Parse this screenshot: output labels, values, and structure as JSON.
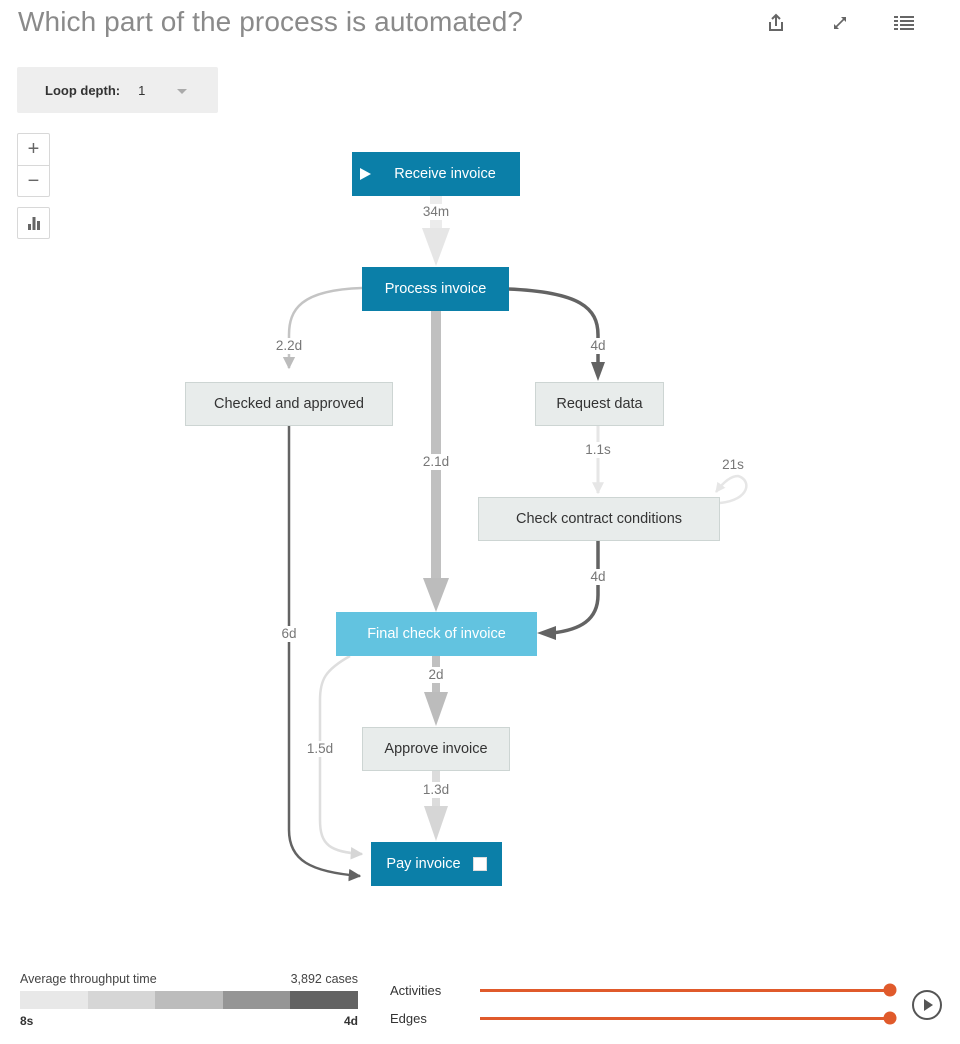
{
  "header": {
    "title": "Which part of the process is automated?",
    "icons": [
      "share-icon",
      "expand-icon",
      "list-icon"
    ]
  },
  "controls": {
    "loop_depth_label": "Loop depth:",
    "loop_depth_value": "1",
    "zoom_in": "+",
    "zoom_out": "−"
  },
  "colors": {
    "node_dark": "#0b7fa8",
    "node_cyan": "#62c3e0",
    "node_light": "#e8eceb",
    "slider": "#e05a2b",
    "legend_scale": [
      "#e8e8e8",
      "#d6d6d6",
      "#bcbcbc",
      "#959595",
      "#636363"
    ]
  },
  "nodes": [
    {
      "id": "receive",
      "label": "Receive invoice",
      "style": "dark",
      "start": true
    },
    {
      "id": "process",
      "label": "Process invoice",
      "style": "dark"
    },
    {
      "id": "checked",
      "label": "Checked and approved",
      "style": "light"
    },
    {
      "id": "request",
      "label": "Request data",
      "style": "light"
    },
    {
      "id": "contract",
      "label": "Check contract conditions",
      "style": "light"
    },
    {
      "id": "final",
      "label": "Final check of invoice",
      "style": "cyan"
    },
    {
      "id": "approve",
      "label": "Approve invoice",
      "style": "light"
    },
    {
      "id": "pay",
      "label": "Pay invoice",
      "style": "dark",
      "end": true
    }
  ],
  "edges": [
    {
      "from": "receive",
      "to": "process",
      "label": "34m",
      "shade": 0
    },
    {
      "from": "process",
      "to": "checked",
      "label": "2.2d",
      "shade": 2
    },
    {
      "from": "process",
      "to": "final",
      "label": "2.1d",
      "shade": 2
    },
    {
      "from": "process",
      "to": "request",
      "label": "4d",
      "shade": 4
    },
    {
      "from": "request",
      "to": "contract",
      "label": "1.1s",
      "shade": 0
    },
    {
      "from": "contract",
      "to": "contract",
      "label": "21s",
      "shade": 0
    },
    {
      "from": "contract",
      "to": "final",
      "label": "4d",
      "shade": 4
    },
    {
      "from": "checked",
      "to": "pay",
      "label": "6d",
      "shade": 4
    },
    {
      "from": "final",
      "to": "approve",
      "label": "2d",
      "shade": 2
    },
    {
      "from": "final",
      "to": "pay",
      "label": "1.5d",
      "shade": 1
    },
    {
      "from": "approve",
      "to": "pay",
      "label": "1.3d",
      "shade": 1
    }
  ],
  "legend": {
    "title": "Average throughput time",
    "cases": "3,892 cases",
    "min": "8s",
    "max": "4d"
  },
  "sliders": [
    {
      "label": "Activities",
      "value": 1.0
    },
    {
      "label": "Edges",
      "value": 1.0
    }
  ]
}
